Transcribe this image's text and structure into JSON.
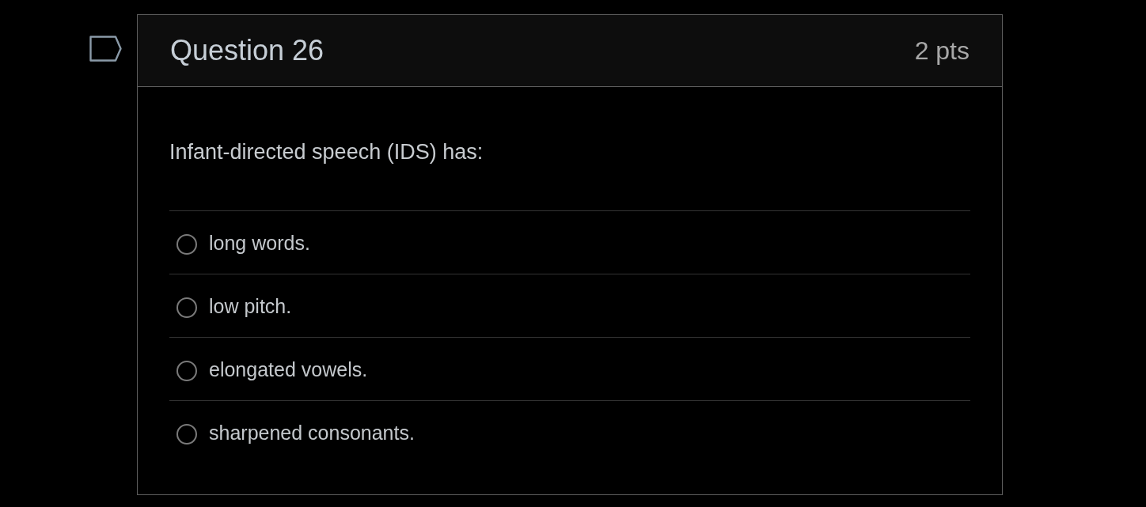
{
  "question": {
    "flagged": false,
    "title": "Question 26",
    "points": "2 pts",
    "text": "Infant-directed speech (IDS) has:",
    "options": [
      {
        "label": "long words.",
        "selected": false
      },
      {
        "label": "low pitch.",
        "selected": false
      },
      {
        "label": "elongated vowels.",
        "selected": false
      },
      {
        "label": "sharpened consonants.",
        "selected": false
      }
    ]
  }
}
